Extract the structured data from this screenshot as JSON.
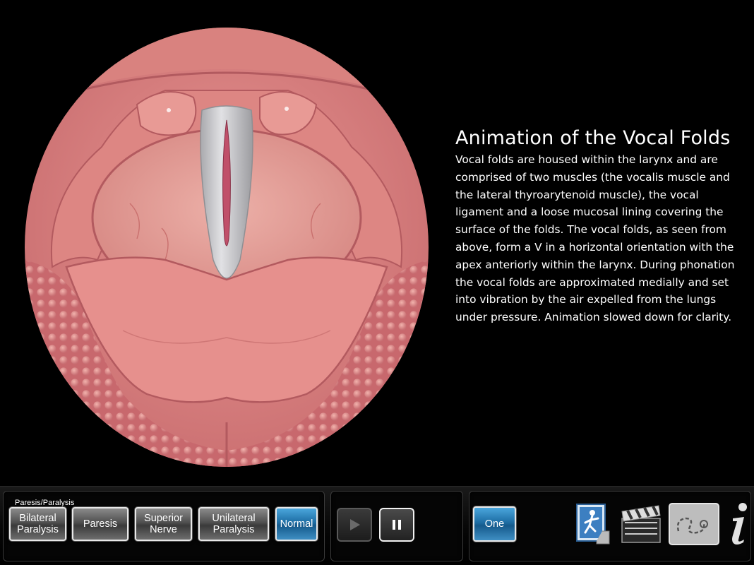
{
  "content": {
    "title": "Animation of the Vocal Folds",
    "description": "Vocal folds are housed within the larynx and are comprised of two muscles (the vocalis muscle and the lateral thyroarytenoid muscle), the vocal ligament and a loose mucosal lining covering the surface of the folds. The vocal folds, as seen from above, form a V in a horizontal orientation with the apex anteriorly within the larynx. During phonation the vocal folds are approximated medially and set into vibration by the air expelled from the lungs under pressure. Animation slowed down for clarity."
  },
  "illustration": {
    "name": "vocal-folds-illustration",
    "colors": {
      "tissue": "#e08a8a",
      "tissue_dark": "#b85a5e",
      "fold": "#c9c9cc",
      "glottis": "#c0506a"
    }
  },
  "toolbar": {
    "group_label": "Paresis/Paralysis",
    "modes": [
      {
        "label": "Bilateral\nParalysis",
        "active": false
      },
      {
        "label": "Paresis",
        "active": false
      },
      {
        "label": "Superior\nNerve",
        "active": false
      },
      {
        "label": "Unilateral\nParalysis",
        "active": false
      },
      {
        "label": "Normal",
        "active": true
      }
    ],
    "playback": {
      "play_icon": "play-icon",
      "pause_icon": "pause-icon"
    },
    "view_button": {
      "label": "One",
      "active": true
    },
    "tools": [
      {
        "icon": "running-figure-icon"
      },
      {
        "icon": "clapperboard-icon"
      },
      {
        "icon": "path-trace-icon"
      },
      {
        "icon": "info-icon"
      }
    ],
    "colors": {
      "accent": "#1d6da4",
      "button_gray": "#4f4f4f",
      "border": "#e8e8e8"
    }
  }
}
